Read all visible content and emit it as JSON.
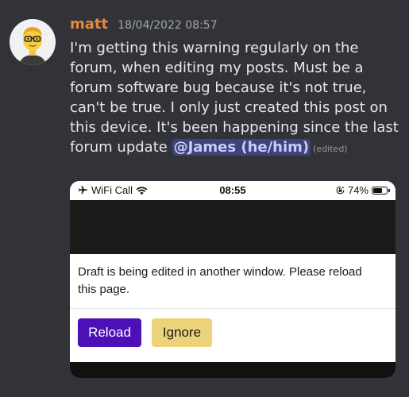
{
  "message": {
    "author": "matt",
    "timestamp": "18/04/2022 08:57",
    "text": "I'm getting this warning regularly on the forum, when editing my posts. Must be a forum software bug because it's not true, can't be true. I only just created this post on this device. It's been happening since the last forum update ",
    "mention": "@James (he/him)",
    "edited_label": "(edited)"
  },
  "screenshot": {
    "status_bar": {
      "carrier": "WiFi Call",
      "time": "08:55",
      "battery": "74%",
      "battery_level": 0.74
    },
    "dialog": {
      "text": "Draft is being edited in another window. Please reload this page.",
      "reload_label": "Reload",
      "ignore_label": "Ignore"
    }
  },
  "icons": {
    "avatar": "memoji-avatar",
    "airplane": "airplane-icon",
    "wifi": "wifi-icon",
    "orientation_lock": "orientation-lock-icon",
    "battery": "battery-icon"
  },
  "colors": {
    "background": "#313338",
    "username": "#e6893b",
    "mention_bg": "#5865f259",
    "reload_button": "#4c0fb8",
    "ignore_button": "#ecd37a"
  }
}
